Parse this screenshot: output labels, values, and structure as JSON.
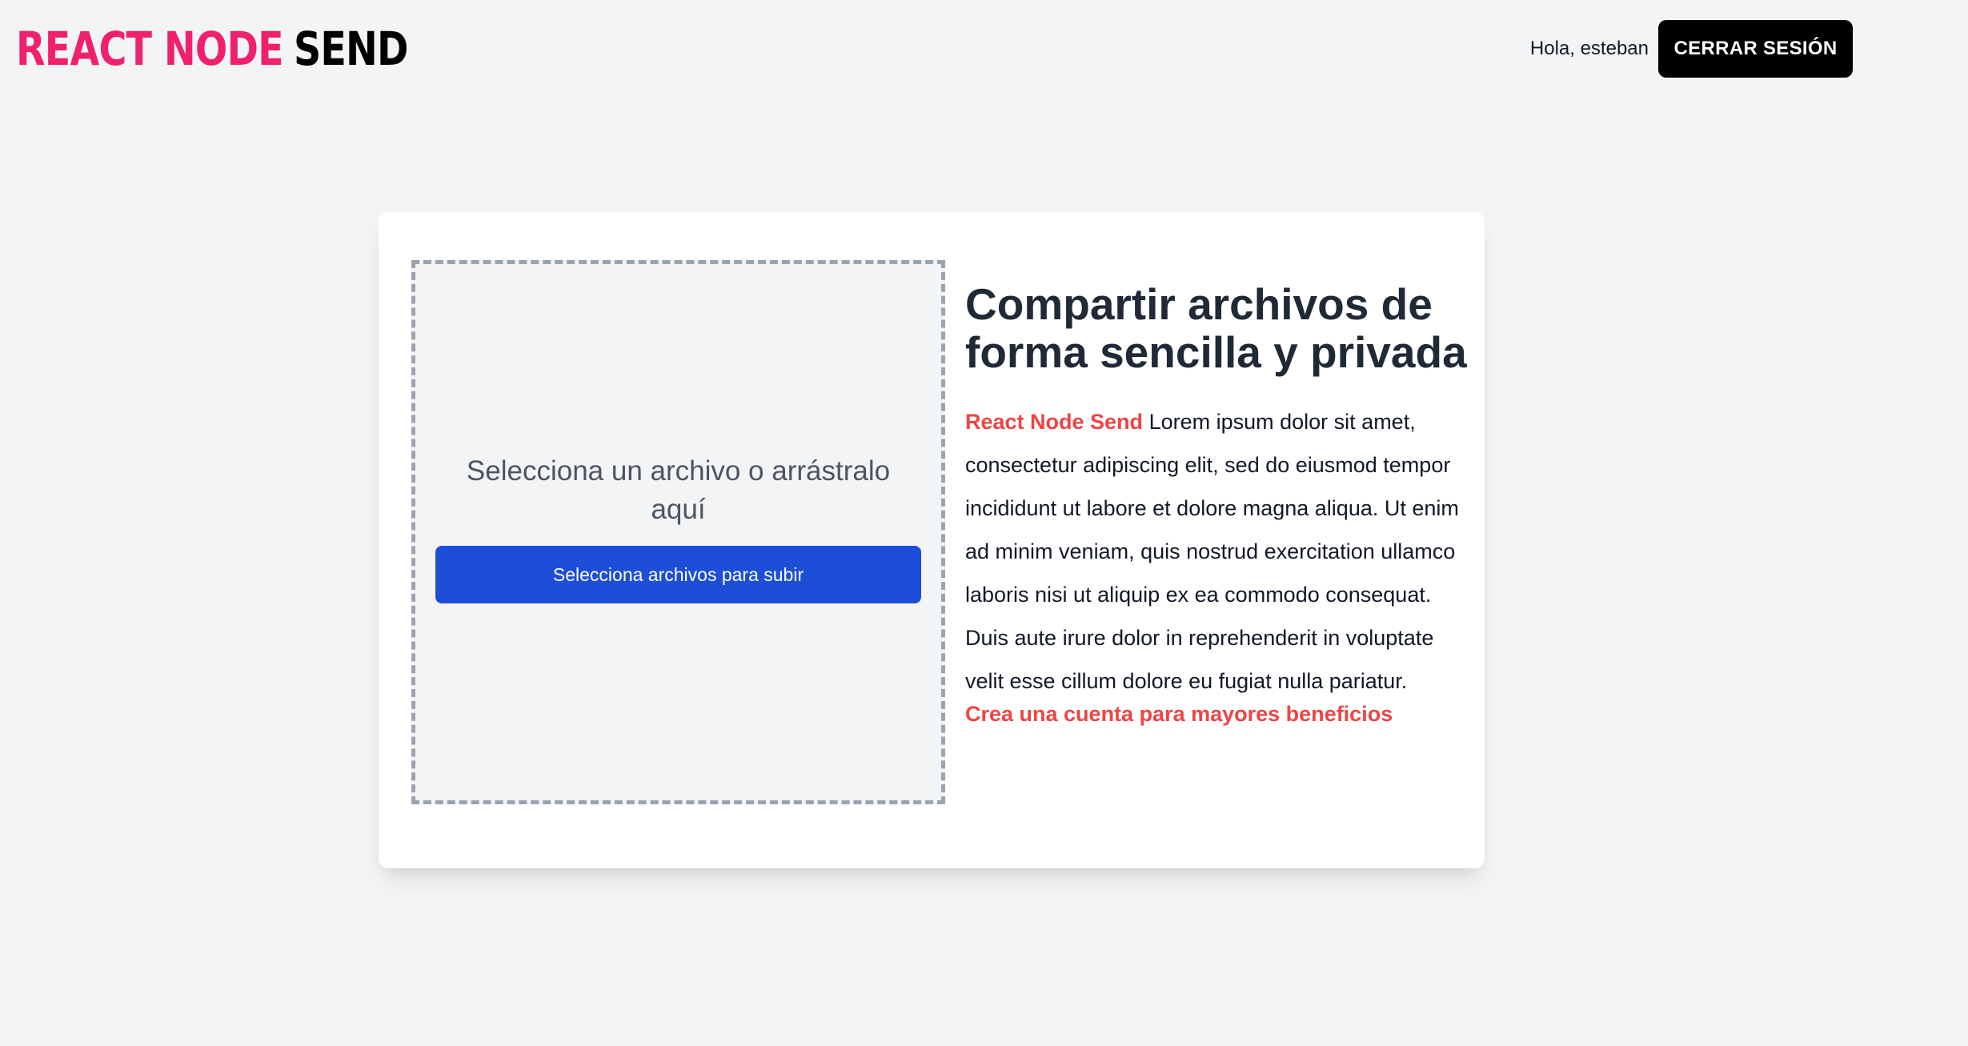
{
  "header": {
    "logo_part1": "REACT NODE",
    "logo_part2": "SEND",
    "greeting": "Hola, esteban",
    "logout_label": "CERRAR SESIÓN"
  },
  "upload": {
    "dropzone_text": "Selecciona un archivo o arrástralo aquí",
    "button_label": "Selecciona archivos para subir"
  },
  "info": {
    "title": "Compartir archivos de forma sencilla y privada",
    "brand": "React Node Send",
    "body": "Lorem ipsum dolor sit amet, consectetur adipiscing elit, sed do eiusmod tempor incididunt ut labore et dolore magna aliqua. Ut enim ad minim veniam, quis nostrud exercitation ullamco laboris nisi ut aliquip ex ea commodo consequat. Duis aute irure dolor in reprehenderit in voluptate velit esse cillum dolore eu fugiat nulla pariatur.",
    "create_account_link": "Crea una cuenta para mayores beneficios"
  },
  "colors": {
    "logo_accent": "#f0216b",
    "primary_button": "#1d4ed8",
    "brand_red": "#ef4444",
    "background": "#f3f4f6"
  }
}
